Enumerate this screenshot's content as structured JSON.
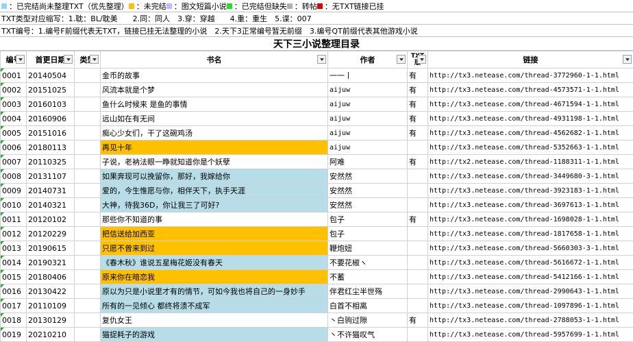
{
  "colors": {
    "accent_blue": "#b7dde8",
    "accent_orange": "#ffc000",
    "legend_blue": "#8fd3ff",
    "legend_orange": "#ffc000",
    "legend_purple": "#c9b6ff",
    "legend_green": "#22e022",
    "legend_gray": "#b0b0b0",
    "legend_red": "#e00000"
  },
  "legend": {
    "blue": "：已完结尚未整理TXT（优先整理）",
    "orange": "：未完结",
    "purple": "：图文短篇小说",
    "green": "：已完结但缺失",
    "gray": "：转帖",
    "red": "：无TXT链接已挂"
  },
  "info": {
    "line1": "TXT类型对应缩写：1.耽：BL/耽美　　2.同：同人　3.穿：穿越　　4.重：重生　5.谍：007",
    "line2": "TXT编号：1.编号F前缀代表无TXT，链接已挂无法整理的小说　2.天下3正常编号暂无前缀　3.编号QT前缀代表其他游戏小说"
  },
  "sheet_title": "天下三小说整理目录",
  "headers": {
    "id": "编号",
    "date": "首更日期",
    "type": "类型",
    "title": "书名",
    "author": "作者",
    "txt": "TXT版",
    "link": "链接"
  },
  "rows": [
    {
      "id": "0001",
      "date": "20140504",
      "title": "金币的故事",
      "author": "一一丨",
      "txt": "有",
      "link": "http://tx3.netease.com/thread-3772960-1-1.html",
      "color": ""
    },
    {
      "id": "0002",
      "date": "20151025",
      "title": "风流本就是个梦",
      "author": "aijuw",
      "txt": "有",
      "link": "http://tx3.netease.com/thread-4573571-1-1.html",
      "color": ""
    },
    {
      "id": "0003",
      "date": "20160103",
      "title": "鱼什么时候来 是鱼的事情",
      "author": "aijuw",
      "txt": "有",
      "link": "http://tx3.netease.com/thread-4671594-1-1.html",
      "color": ""
    },
    {
      "id": "0004",
      "date": "20160906",
      "title": "远山如在有无间",
      "author": "aijuw",
      "txt": "有",
      "link": "http://tx3.netease.com/thread-4931198-1-1.html",
      "color": ""
    },
    {
      "id": "0005",
      "date": "20151016",
      "title": "痴心少女们，干了这碗鸡汤",
      "author": "aijuw",
      "txt": "有",
      "link": "http://tx3.netease.com/thread-4562682-1-1.html",
      "color": ""
    },
    {
      "id": "0006",
      "date": "20180113",
      "title": "再见十年",
      "author": "aijuw",
      "txt": "",
      "link": "http://tx3.netease.com/thread-5352663-1-1.html",
      "color": "orange"
    },
    {
      "id": "0007",
      "date": "20110325",
      "title": "子说，老衲法眼一睁就知道你是个妖孽",
      "author": "阿难",
      "txt": "有",
      "link": "http://tx2.netease.com/thread-1188311-1-1.html",
      "color": ""
    },
    {
      "id": "0008",
      "date": "20131107",
      "title": "如果奔现可以挽留你，那好，我嫁给你",
      "author": "安然然",
      "txt": "",
      "link": "http://tx3.netease.com/thread-3449680-3-1.html",
      "color": "blue"
    },
    {
      "id": "0009",
      "date": "20140731",
      "title": "爱的，今生惟愿与你，相伴天下，执手天涯",
      "author": "安然然",
      "txt": "",
      "link": "http://tx3.netease.com/thread-3923183-1-1.html",
      "color": "blue"
    },
    {
      "id": "0010",
      "date": "20140321",
      "title": "大神，待我36D，你让我三了可好?",
      "author": "安然然",
      "txt": "",
      "link": "http://tx3.netease.com/thread-3697613-1-1.html",
      "color": "blue"
    },
    {
      "id": "0011",
      "date": "20120102",
      "title": "那些你不知道的事",
      "author": "包子",
      "txt": "有",
      "link": "http://tx3.netease.com/thread-1698028-1-1.html",
      "color": ""
    },
    {
      "id": "0012",
      "date": "20120229",
      "title": "把信送给加西亚",
      "author": "包子",
      "txt": "",
      "link": "http://tx3.netease.com/thread-1817658-1-1.html",
      "color": "orange"
    },
    {
      "id": "0013",
      "date": "20190615",
      "title": "只愿不曾来到过",
      "author": "鞭炮妞",
      "txt": "",
      "link": "http://tx3.netease.com/thread-5660303-3-1.html",
      "color": "orange"
    },
    {
      "id": "0014",
      "date": "20190321",
      "title": "《春木秋》谁说五星梅花姬没有春天",
      "author": "不要花椒ヽ",
      "txt": "",
      "link": "http://tx3.netease.com/thread-5616672-1-1.html",
      "color": "blue"
    },
    {
      "id": "0015",
      "date": "20180406",
      "title": "原来你在暗恋我",
      "author": "不蓄",
      "txt": "",
      "link": "http://tx3.netease.com/thread-5412166-1-1.html",
      "color": "orange"
    },
    {
      "id": "0016",
      "date": "20130422",
      "title": "原以为只是小说里才有的情节，可如今我也将自己的一身妙手",
      "author": "伴君红尘半世殇",
      "txt": "",
      "link": "http://tx3.netease.com/thread-2990643-1-1.html",
      "color": "blue"
    },
    {
      "id": "0017",
      "date": "20110109",
      "title": "所有的一见倾心 都终将溃不成军",
      "author": "白首不相离",
      "txt": "",
      "link": "http://tx3.netease.com/thread-1097896-1-1.html",
      "color": "blue"
    },
    {
      "id": "0018",
      "date": "20130129",
      "title": "复仇女王",
      "author": "丶白驹过隙",
      "txt": "有",
      "link": "http://tx3.netease.com/thread-2788053-1-1.html",
      "color": ""
    },
    {
      "id": "0019",
      "date": "20210210",
      "title": "猫捉耗子的游戏",
      "author": "丶不许猫叹气",
      "txt": "",
      "link": "http://tx3.netease.com/thread-5957699-1-1.html",
      "color": "blue"
    }
  ]
}
